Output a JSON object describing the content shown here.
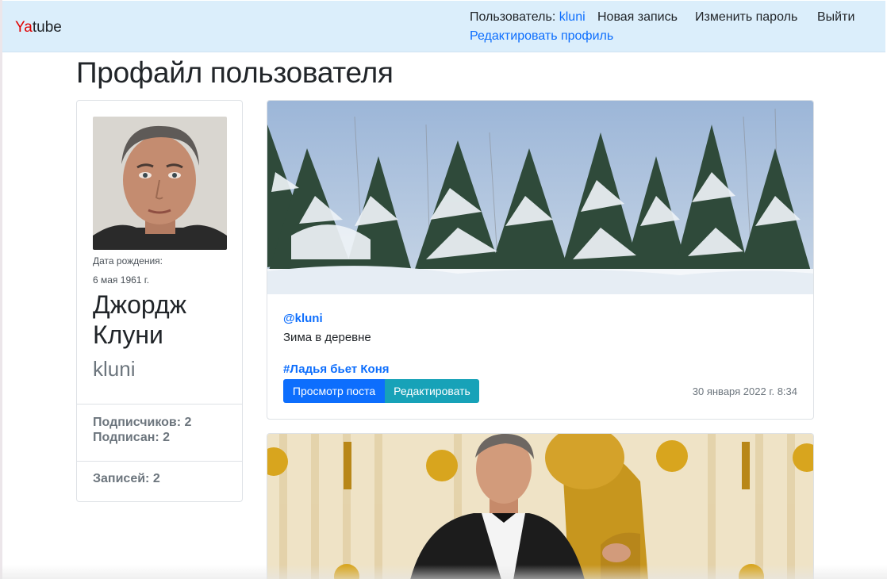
{
  "navbar": {
    "brand_ya": "Ya",
    "brand_tube": "tube",
    "user_label": "Пользователь:",
    "user_name": "kluni",
    "new_post": "Новая запись",
    "change_password": "Изменить пароль",
    "logout": "Выйти",
    "edit_profile": "Редактировать профиль"
  },
  "page": {
    "title": "Профайл пользователя"
  },
  "profile": {
    "birth_label": "Дата рождения:",
    "birth_date": "6 мая 1961 г.",
    "first_name": "Джордж",
    "last_name": "Клуни",
    "username": "kluni",
    "followers": "Подписчиков: 2",
    "following": "Подписан: 2",
    "posts": "Записей: 2"
  },
  "posts": [
    {
      "author": "@kluni",
      "text": "Зима в деревне",
      "group": "#Ладья бьет Коня",
      "view_button": "Просмотр поста",
      "edit_button": "Редактировать",
      "date": "30 января 2022 г. 8:34"
    }
  ],
  "colors": {
    "accent": "#0d6efd",
    "info": "#17a2b8",
    "navbar_bg": "#dbeefb",
    "brand_red": "#e00000"
  }
}
